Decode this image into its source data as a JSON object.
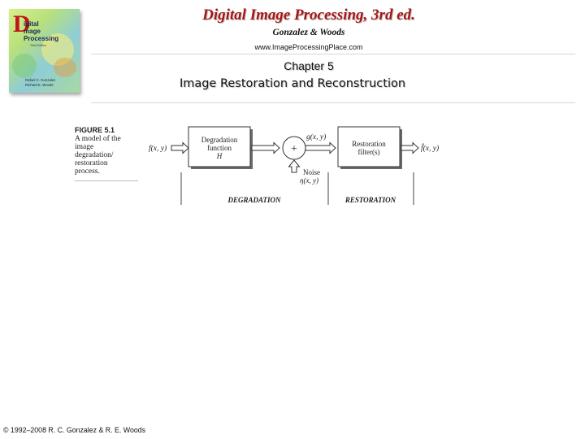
{
  "book_cover": {
    "title_initial": "D",
    "title_lines": [
      "igital",
      "mage",
      "Processing"
    ],
    "subtitle": "Third Edition",
    "authors": [
      "Rafael C. Gonzalez",
      "Richard E. Woods"
    ]
  },
  "header": {
    "title": "Digital Image Processing, 3rd ed.",
    "authors": "Gonzalez & Woods",
    "url": "www.ImageProcessingPlace.com"
  },
  "slide": {
    "chapter": "Chapter 5",
    "subtitle": "Image Restoration and Reconstruction"
  },
  "figure": {
    "label": "FIGURE 5.1",
    "caption_lines": [
      "A model of the",
      "image",
      "degradation/",
      "restoration",
      "process."
    ],
    "input": "f(x, y)",
    "degradation_box": [
      "Degradation",
      "function",
      "H"
    ],
    "sum_symbol": "+",
    "noise_label": [
      "Noise",
      "η(x, y)"
    ],
    "intermediate": "g(x, y)",
    "restoration_box": [
      "Restoration",
      "filter(s)"
    ],
    "output": "f̂(x, y)",
    "stage_degradation": "DEGRADATION",
    "stage_restoration": "RESTORATION"
  },
  "footer": {
    "copyright": "© 1992–2008  R. C. Gonzalez & R. E. Woods"
  },
  "colors": {
    "title_red": "#a51616",
    "cover_d_red": "#c0141a"
  }
}
